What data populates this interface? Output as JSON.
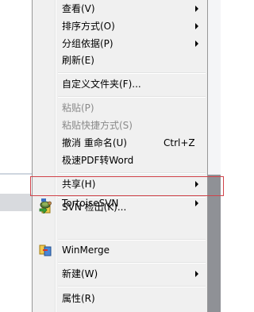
{
  "menu": {
    "view": "查看(V)",
    "sort": "排序方式(O)",
    "group": "分组依据(P)",
    "refresh": "刷新(E)",
    "customize": "自定义文件夹(F)...",
    "paste": "粘贴(P)",
    "paste_shortcut": "粘贴快捷方式(S)",
    "undo": "撤消 重命名(U)",
    "undo_shortcut": "Ctrl+Z",
    "pdf": "极速PDF转Word",
    "share": "共享(H)",
    "svn_checkout": "SVN 检出(K)...",
    "tortoise": "TortoiseSVN",
    "winmerge": "WinMerge",
    "new": "新建(W)",
    "properties": "属性(R)"
  },
  "colors": {
    "highlight_border": "#d0434a",
    "disabled_text": "#8a8a8a"
  },
  "icons": {
    "svn_checkout": "svn-checkout-icon",
    "tortoise": "tortoisesvn-icon",
    "winmerge": "winmerge-icon"
  }
}
